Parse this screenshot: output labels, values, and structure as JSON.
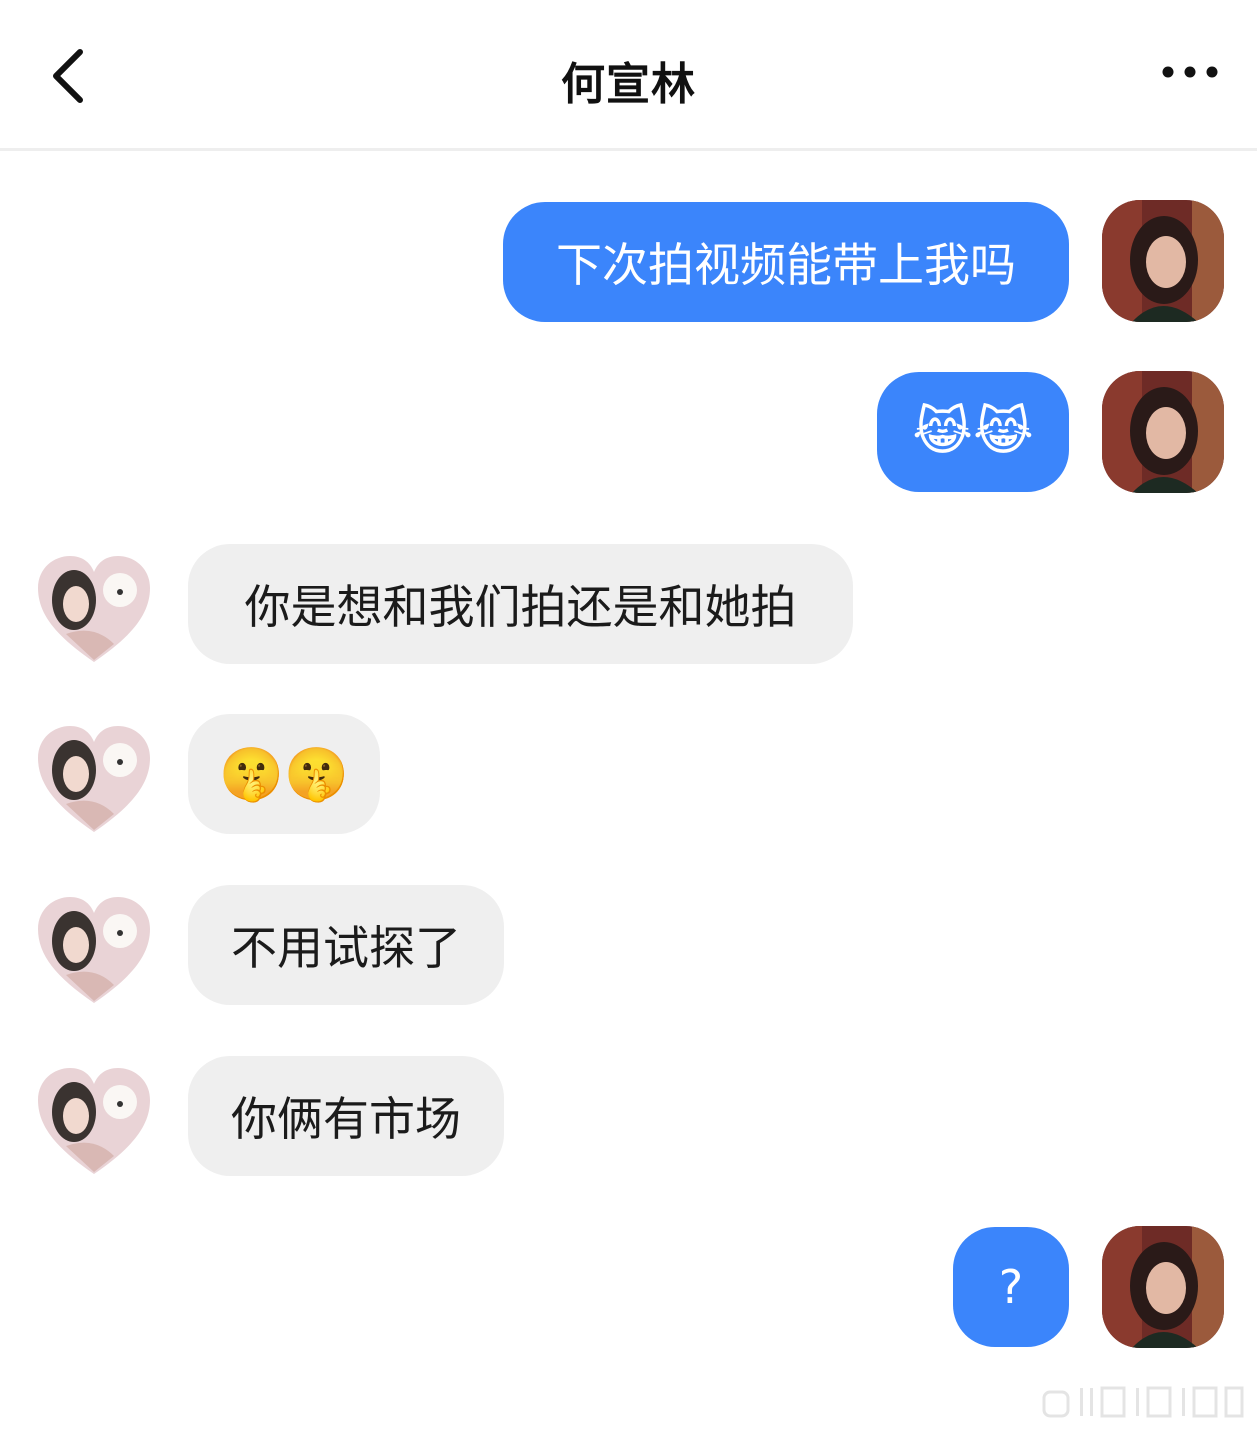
{
  "header": {
    "title": "何宣林",
    "back_icon": "chevron-left-icon",
    "more_icon": "more-horizontal-icon"
  },
  "messages": [
    {
      "direction": "outgoing",
      "text": "下次拍视频能带上我吗"
    },
    {
      "direction": "outgoing",
      "text": "😹😹"
    },
    {
      "direction": "incoming",
      "text": "你是想和我们拍还是和她拍"
    },
    {
      "direction": "incoming",
      "text": "🤫🤫"
    },
    {
      "direction": "incoming",
      "text": "不用试探了"
    },
    {
      "direction": "incoming",
      "text": "你俩有市场"
    },
    {
      "direction": "outgoing",
      "text": "?"
    }
  ],
  "colors": {
    "outgoing_bubble": "#3b85fb",
    "incoming_bubble": "#efefef",
    "header_divider": "#eeeeee"
  }
}
